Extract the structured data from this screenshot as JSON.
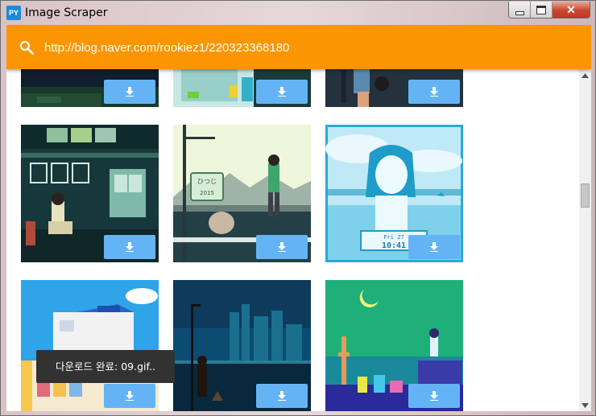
{
  "window": {
    "title": "Image Scraper",
    "icon_text": "PY",
    "controls": {
      "minimize_icon": "minimize-icon",
      "maximize_icon": "maximize-icon",
      "close_icon": "close-icon"
    }
  },
  "search": {
    "icon": "search-icon",
    "url_value": "http://blog.naver.com/rookiez1/220323368180"
  },
  "colors": {
    "app_bar": "#fb9602",
    "download_button": "#64b4f5",
    "toast_bg": "#323232"
  },
  "gallery": {
    "download_icon": "download-icon",
    "rows": [
      {
        "partially_visible": true,
        "tiles": [
          "pixel-night-scene",
          "pixel-vending-frog",
          "pixel-reading-person"
        ]
      },
      {
        "tiles": [
          "pixel-train-interior",
          "pixel-bus-stop",
          "pixel-blue-girl-phone"
        ]
      },
      {
        "tiles": [
          "pixel-seaside-house",
          "pixel-night-city",
          "pixel-crescent-tower"
        ]
      }
    ]
  },
  "embedded_text": {
    "bus_stop_sign_top": "ひつじ",
    "bus_stop_sign_year": "2015",
    "phone_clock_date": "Fri 27",
    "phone_clock_time": "10:41"
  },
  "toast": {
    "message": "다운로드 완료: 09.gif.."
  }
}
